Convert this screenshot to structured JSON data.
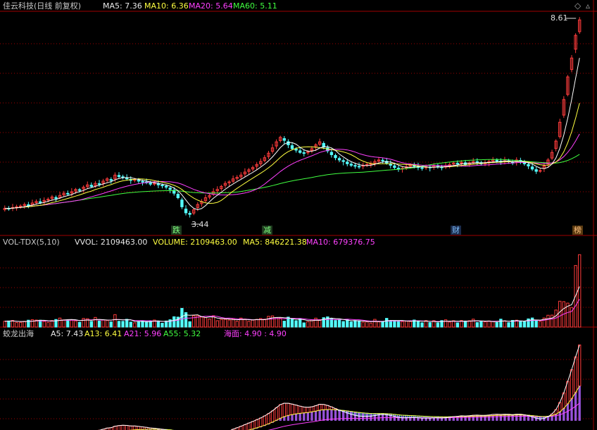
{
  "header": {
    "title": "佳云科技(日线 前复权)",
    "ma5": "MA5: 7.36",
    "ma10": "MA10: 6.36",
    "ma20": "MA20: 5.64",
    "ma60": "MA60: 5.11"
  },
  "price_panel": {
    "high_label": "8.61",
    "low_label": "3.44",
    "markers": [
      "跌",
      "减",
      "财",
      "榜"
    ]
  },
  "volume_panel": {
    "name": "VOL-TDX(5,10)",
    "vvol": "VVOL: 2109463.00",
    "volume": "VOLUME: 2109463.00",
    "ma5": "MA5: 846221.38",
    "ma10": "MA10: 679376.75"
  },
  "indicator_panel": {
    "name": "蛟龙出海",
    "a5": "A5: 7.43",
    "a13": "A13: 6.41",
    "a21": "A21: 5.96",
    "a55": "A55: 5.32",
    "haimian": "海面: 4.90 : 4.90"
  },
  "colors": {
    "up": "#ff3c3c",
    "down": "#54ffff",
    "ma5": "#ffffff",
    "ma10": "#ffff40",
    "ma20": "#ff40ff",
    "ma60": "#40ff40",
    "axis": "#a00000"
  },
  "chart_data": [
    {
      "type": "candlestick",
      "title": "佳云科技(日线 前复权)",
      "ylim": [
        3.2,
        8.8
      ],
      "annotations": {
        "high": 8.61,
        "low": 3.44
      },
      "series": [
        {
          "name": "MA5",
          "value": 7.36
        },
        {
          "name": "MA10",
          "value": 6.36
        },
        {
          "name": "MA20",
          "value": 5.64
        },
        {
          "name": "MA60",
          "value": 5.11
        }
      ],
      "close": [
        3.62,
        3.61,
        3.64,
        3.66,
        3.68,
        3.72,
        3.7,
        3.76,
        3.8,
        3.78,
        3.83,
        3.86,
        3.92,
        3.88,
        3.96,
        4.02,
        4.0,
        4.06,
        4.12,
        4.1,
        4.18,
        4.24,
        4.2,
        4.28,
        4.26,
        4.34,
        4.4,
        4.36,
        4.5,
        4.46,
        4.44,
        4.4,
        4.36,
        4.38,
        4.34,
        4.32,
        4.3,
        4.26,
        4.28,
        4.24,
        4.22,
        4.18,
        4.12,
        4.02,
        3.9,
        3.66,
        3.5,
        3.46,
        3.58,
        3.72,
        3.8,
        3.9,
        3.96,
        4.06,
        4.12,
        4.2,
        4.28,
        4.32,
        4.4,
        4.44,
        4.5,
        4.58,
        4.64,
        4.7,
        4.78,
        4.86,
        4.96,
        5.08,
        5.22,
        5.38,
        5.5,
        5.42,
        5.3,
        5.2,
        5.16,
        5.1,
        5.08,
        5.12,
        5.2,
        5.3,
        5.38,
        5.24,
        5.14,
        5.04,
        4.96,
        4.9,
        4.86,
        4.8,
        4.76,
        4.74,
        4.72,
        4.76,
        4.78,
        4.8,
        4.86,
        4.9,
        4.88,
        4.82,
        4.76,
        4.7,
        4.66,
        4.68,
        4.72,
        4.76,
        4.74,
        4.7,
        4.68,
        4.72,
        4.7,
        4.74,
        4.72,
        4.7,
        4.74,
        4.78,
        4.82,
        4.8,
        4.84,
        4.78,
        4.82,
        4.86,
        4.84,
        4.8,
        4.82,
        4.86,
        4.9,
        4.88,
        4.84,
        4.88,
        4.86,
        4.82,
        4.9,
        4.86,
        4.8,
        4.74,
        4.66,
        4.6,
        4.62,
        4.74,
        4.9,
        5.1,
        5.4,
        5.9,
        6.5,
        7.1,
        7.6,
        8.2,
        8.61
      ],
      "volume_ylim": [
        0,
        2300000
      ],
      "volume_last": 2109463,
      "volume_ma5": 846221.38,
      "volume_ma10": 679376.75
    },
    {
      "type": "line",
      "title": "蛟龙出海",
      "series": [
        {
          "name": "A5",
          "value": 7.43
        },
        {
          "name": "A13",
          "value": 6.41
        },
        {
          "name": "A21",
          "value": 5.96
        },
        {
          "name": "A55",
          "value": 5.32
        },
        {
          "name": "海面",
          "value": 4.9
        }
      ]
    }
  ]
}
